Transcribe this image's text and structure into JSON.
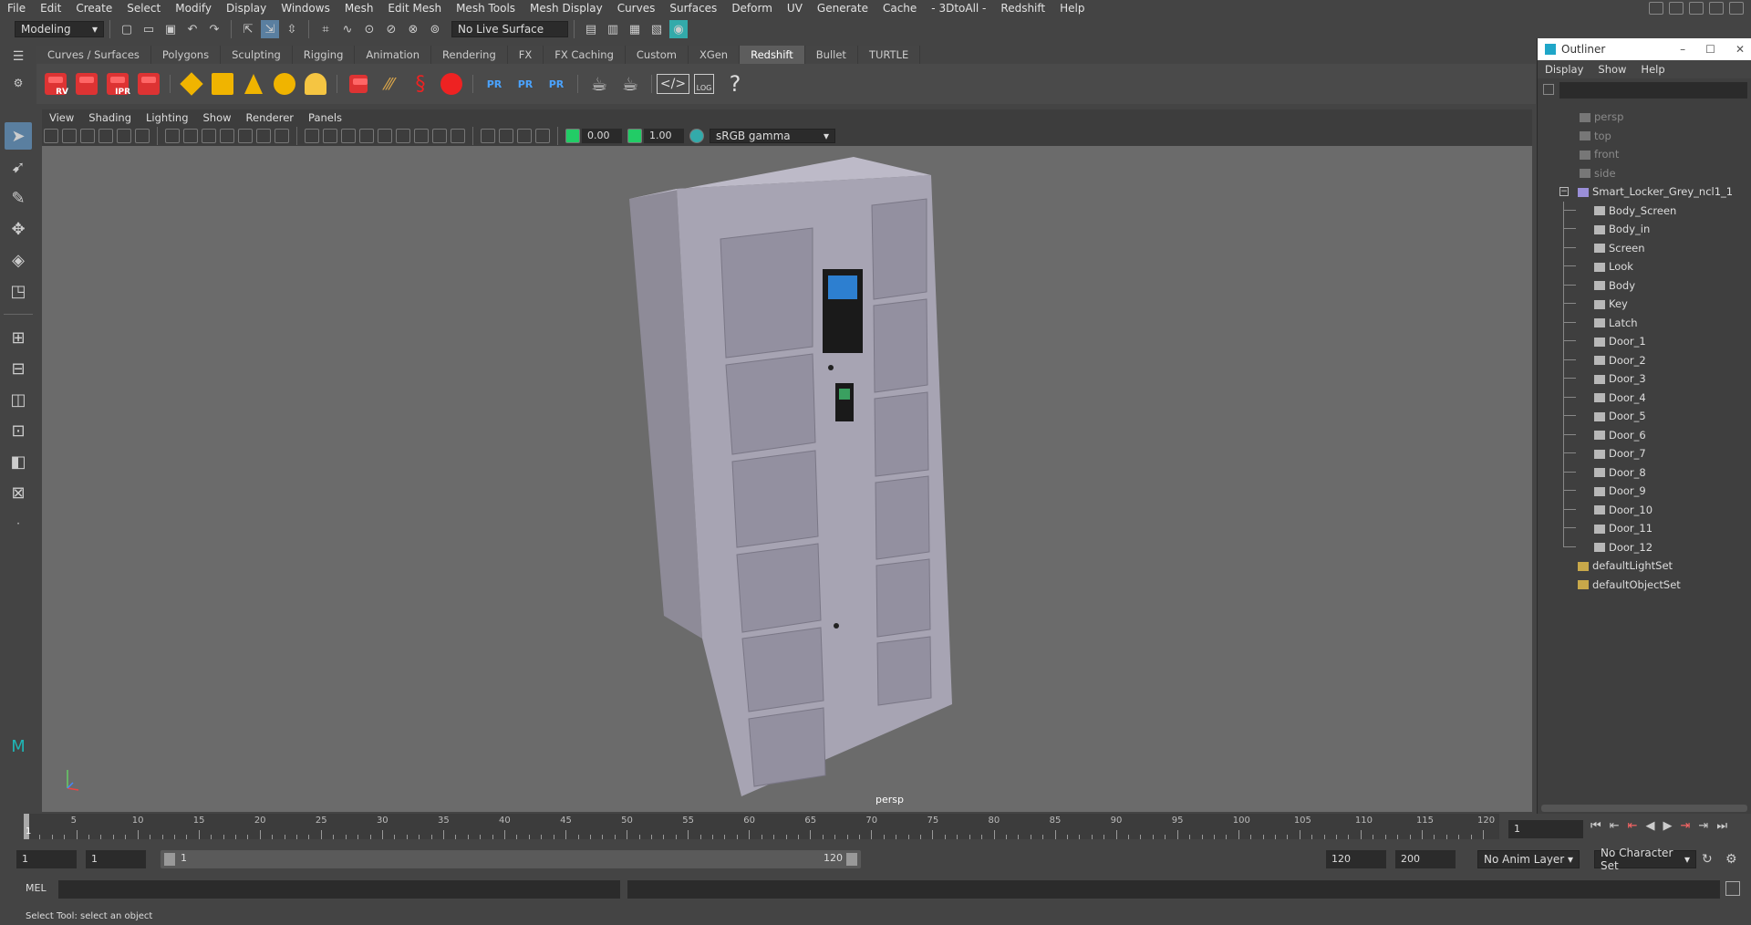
{
  "menubar": {
    "items": [
      "File",
      "Edit",
      "Create",
      "Select",
      "Modify",
      "Display",
      "Windows",
      "Mesh",
      "Edit Mesh",
      "Mesh Tools",
      "Mesh Display",
      "Curves",
      "Surfaces",
      "Deform",
      "UV",
      "Generate",
      "Cache",
      "- 3DtoAll -",
      "Redshift",
      "Help"
    ]
  },
  "statusline": {
    "mode": "Modeling",
    "live_surface": "No Live Surface"
  },
  "shelf": {
    "tabs": [
      "Curves / Surfaces",
      "Polygons",
      "Sculpting",
      "Rigging",
      "Animation",
      "Rendering",
      "FX",
      "FX Caching",
      "Custom",
      "XGen",
      "Redshift",
      "Bullet",
      "TURTLE"
    ],
    "active_tab": "Redshift",
    "rs_labels": [
      "RV",
      "IPR"
    ],
    "pr_labels": [
      "PR",
      "PR",
      "PR"
    ],
    "log_label": "LOG",
    "help_label": "?"
  },
  "panel": {
    "menu": [
      "View",
      "Shading",
      "Lighting",
      "Show",
      "Renderer",
      "Panels"
    ],
    "exposure": "0.00",
    "gamma": "1.00",
    "color_space": "sRGB gamma",
    "camera_label": "persp"
  },
  "outliner": {
    "title": "Outliner",
    "menu": [
      "Display",
      "Show",
      "Help"
    ],
    "cameras": [
      "persp",
      "top",
      "front",
      "side"
    ],
    "group": "Smart_Locker_Grey_ncl1_1",
    "children": [
      "Body_Screen",
      "Body_in",
      "Screen",
      "Look",
      "Body",
      "Key",
      "Latch",
      "Door_1",
      "Door_2",
      "Door_3",
      "Door_4",
      "Door_5",
      "Door_6",
      "Door_7",
      "Door_8",
      "Door_9",
      "Door_10",
      "Door_11",
      "Door_12"
    ],
    "sets": [
      "defaultLightSet",
      "defaultObjectSet"
    ]
  },
  "timeline": {
    "ticks": [
      5,
      10,
      15,
      20,
      25,
      30,
      35,
      40,
      45,
      50,
      55,
      60,
      65,
      70,
      75,
      80,
      85,
      90,
      95,
      100,
      105,
      110,
      115,
      120
    ],
    "start_frame": "1",
    "current_frame": "1"
  },
  "range": {
    "start": "1",
    "playback_start": "1",
    "slider_start": "1",
    "slider_end": "120",
    "playback_end": "120",
    "end": "200",
    "anim_layer": "No Anim Layer",
    "char_set": "No Character Set"
  },
  "cmd": {
    "lang": "MEL"
  },
  "help": {
    "text": "Select Tool: select an object"
  },
  "colors": {
    "viewport_bg": "#6b6b6b",
    "active_tab": "#5d5d5d",
    "accent_blue": "#4aa3ff",
    "redshift_red": "#d33333"
  }
}
